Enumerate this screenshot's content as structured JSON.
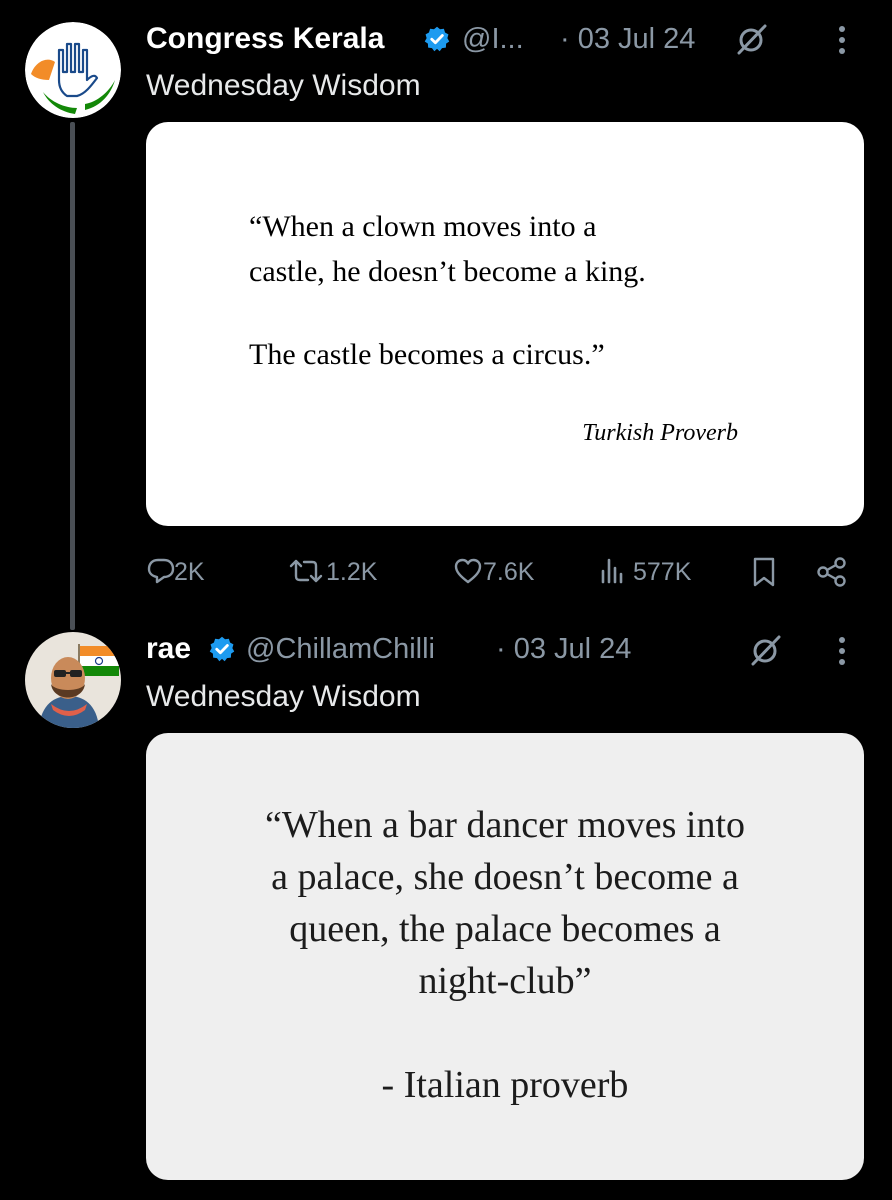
{
  "thread": {
    "tweets": [
      {
        "display_name": "Congress Kerala",
        "verified": true,
        "handle": "@I...",
        "date_text": "· 03 Jul 24",
        "text": "Wednesday Wisdom",
        "avatar_icon": "congress-hand-logo-avatar",
        "media": {
          "quote_lines": [
            "“When a clown moves into a",
            "castle, he doesn’t become a king."
          ],
          "quote_lines_2": [
            "The castle becomes a circus.”"
          ],
          "attribution": "Turkish Proverb"
        },
        "actions": {
          "replies": "2K",
          "reposts": "1.2K",
          "likes": "7.6K",
          "views": "577K"
        }
      },
      {
        "display_name": "rae",
        "verified": true,
        "handle": "@ChillamChilli",
        "date_text": "· 03 Jul 24",
        "text": "Wednesday Wisdom",
        "avatar_icon": "profile-photo-avatar",
        "media": {
          "quote_lines": [
            "“When a bar dancer moves into",
            "a palace, she doesn’t become a",
            "queen, the palace becomes a",
            "night-club”"
          ],
          "attribution": "- Italian proverb"
        }
      }
    ]
  },
  "colors": {
    "background": "#000000",
    "primary_text": "#e7e9ea",
    "secondary_text": "#8b98a5",
    "verified_badge": "#1d9bf0",
    "thread_line": "#4a4f55"
  },
  "icons": [
    "verified-badge-icon",
    "grok-icon",
    "more-icon",
    "reply-icon",
    "repost-icon",
    "like-icon",
    "views-icon",
    "bookmark-icon",
    "share-icon"
  ]
}
